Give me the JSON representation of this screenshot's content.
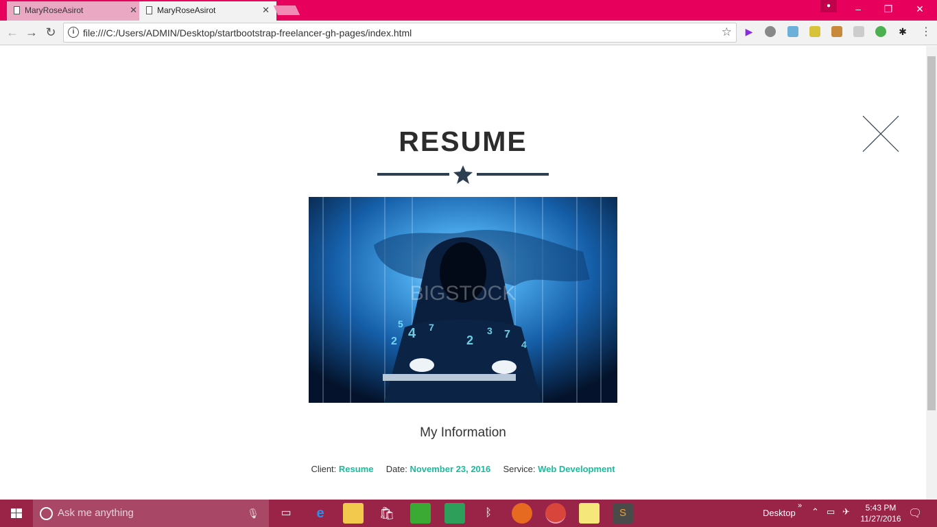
{
  "browser": {
    "tabs": [
      {
        "label": "MaryRoseAsirot"
      },
      {
        "label": "MaryRoseAsirot"
      }
    ],
    "profile_icon": "person-icon",
    "window_controls": {
      "minimize": "–",
      "restore": "❐",
      "close": "✕"
    },
    "address": "file:///C:/Users/ADMIN/Desktop/startbootstrap-freelancer-gh-pages/index.html",
    "accent_color": "#e8005d"
  },
  "page": {
    "title": "RESUME",
    "hero_image_alt": "hooded hacker at keyboard",
    "subtitle": "My Information",
    "meta": {
      "client_label": "Client:",
      "client_value": "Resume",
      "date_label": "Date:",
      "date_value": "November 23, 2016",
      "service_label": "Service:",
      "service_value": "Web Development"
    },
    "accent_color": "#18bc9c",
    "watermark": "BIGSTOCK"
  },
  "taskbar": {
    "search_placeholder": "Ask me anything",
    "desktop_label": "Desktop",
    "time": "5:43 PM",
    "date": "11/27/2016",
    "color": "#9a2348"
  }
}
